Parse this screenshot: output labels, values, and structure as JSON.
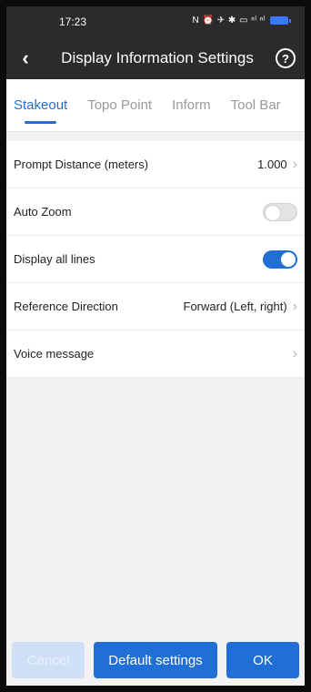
{
  "status_bar": {
    "time": "17:23",
    "icons_text": "N ⏰ ✈ ✱ ▭ ⁿˡ ⁿˡ"
  },
  "header": {
    "back_icon": "‹",
    "title": "Display Information Settings",
    "help_icon": "?"
  },
  "tabs": [
    {
      "label": "Stakeout",
      "active": true
    },
    {
      "label": "Topo Point",
      "active": false
    },
    {
      "label": "Inform",
      "active": false
    },
    {
      "label": "Tool Bar",
      "active": false
    }
  ],
  "settings": {
    "prompt_distance": {
      "label": "Prompt Distance (meters)",
      "value": "1.000"
    },
    "auto_zoom": {
      "label": "Auto Zoom",
      "enabled": false
    },
    "display_all_lines": {
      "label": "Display all lines",
      "enabled": true
    },
    "reference_direction": {
      "label": "Reference Direction",
      "value": "Forward (Left, right)"
    },
    "voice_message": {
      "label": "Voice message"
    }
  },
  "footer": {
    "cancel_label": "Cancel",
    "default_label": "Default settings",
    "ok_label": "OK"
  },
  "colors": {
    "accent": "#1f6fd6",
    "topbar": "#2b2b2b",
    "background": "#f2f2f2"
  }
}
